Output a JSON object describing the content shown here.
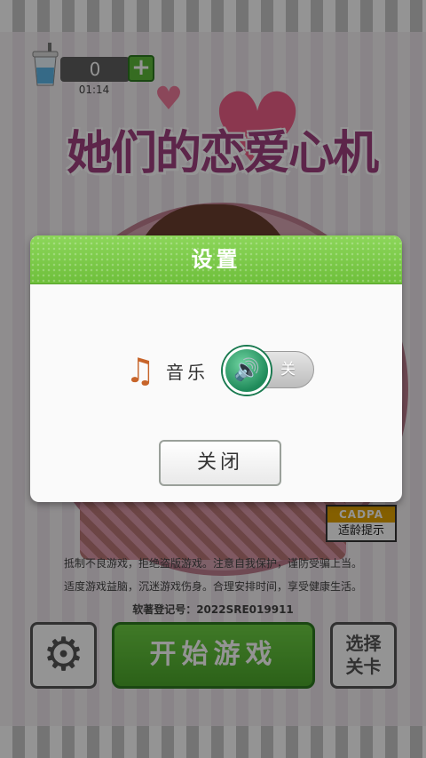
{
  "hud": {
    "coins": "0",
    "timer": "01:14",
    "plus_label": "+"
  },
  "logo": {
    "title": "她们的恋爱心机"
  },
  "cadpa": {
    "badge": "CADPA",
    "label": "适龄提示"
  },
  "notice": {
    "line1": "抵制不良游戏，拒绝盗版游戏。注意自我保护，谨防受骗上当。",
    "line2": "适度游戏益脑，沉迷游戏伤身。合理安排时间，享受健康生活。",
    "line3": "软著登记号：2022SRE019911"
  },
  "buttons": {
    "start": "开始游戏",
    "level_select": "选择关卡"
  },
  "dialog": {
    "title": "设置",
    "music_label": "音乐",
    "toggle_state": "关",
    "close_label": "关闭"
  },
  "icons": {
    "note": "music-note-icon",
    "speaker": "speaker-icon",
    "gear": "gear-icon",
    "cup": "drink-cup-icon"
  },
  "colors": {
    "accent_green": "#6ebf3b",
    "brand_pink": "#f05f88"
  }
}
